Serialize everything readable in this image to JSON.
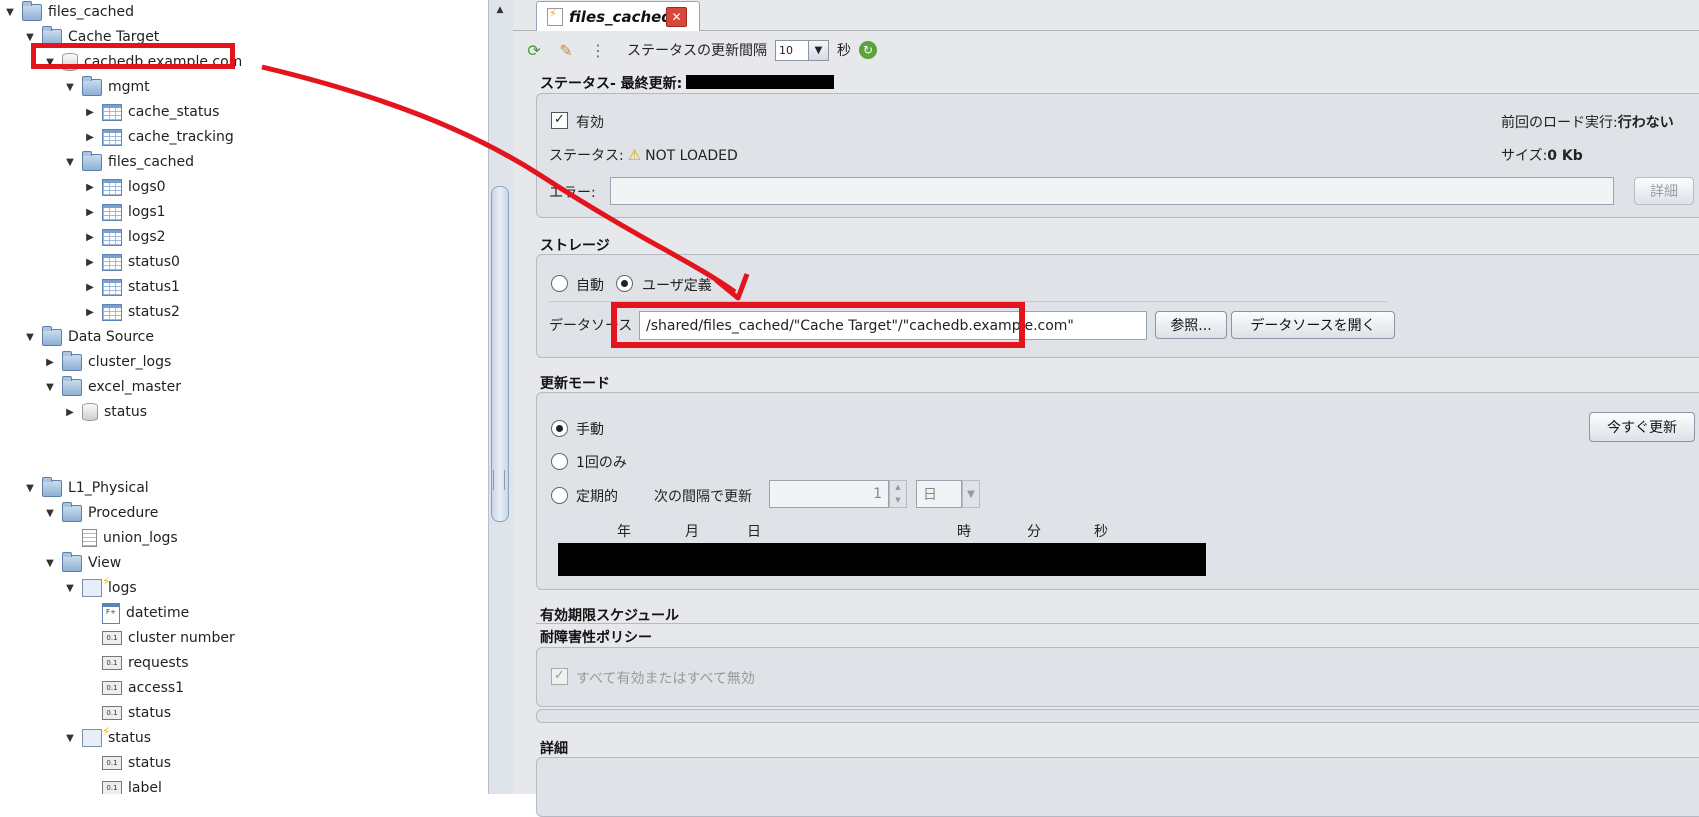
{
  "tree": {
    "items": [
      {
        "label": "files_cached",
        "icon": "folder",
        "toggle": "▼",
        "level": 0
      },
      {
        "label": "Cache Target",
        "icon": "folder",
        "toggle": "▼",
        "level": 1
      },
      {
        "label": "cachedb.example.com",
        "icon": "database",
        "toggle": "▼",
        "level": 2
      },
      {
        "label": "mgmt",
        "icon": "folder",
        "toggle": "▼",
        "level": 3
      },
      {
        "label": "cache_status",
        "icon": "table",
        "toggle": "▶",
        "level": 4
      },
      {
        "label": "cache_tracking",
        "icon": "table",
        "toggle": "▶",
        "level": 4
      },
      {
        "label": "files_cached",
        "icon": "folder",
        "toggle": "▼",
        "level": 3
      },
      {
        "label": "logs0",
        "icon": "table",
        "toggle": "▶",
        "level": 4
      },
      {
        "label": "logs1",
        "icon": "table",
        "toggle": "▶",
        "level": 4
      },
      {
        "label": "logs2",
        "icon": "table",
        "toggle": "▶",
        "level": 4
      },
      {
        "label": "status0",
        "icon": "table",
        "toggle": "▶",
        "level": 4
      },
      {
        "label": "status1",
        "icon": "table",
        "toggle": "▶",
        "level": 4
      },
      {
        "label": "status2",
        "icon": "table",
        "toggle": "▶",
        "level": 4
      },
      {
        "label": "Data Source",
        "icon": "folder",
        "toggle": "▼",
        "level": 1
      },
      {
        "label": "cluster_logs",
        "icon": "folder",
        "toggle": "▶",
        "level": 2
      },
      {
        "label": "excel_master",
        "icon": "folder",
        "toggle": "▼",
        "level": 2
      },
      {
        "label": "status",
        "icon": "database",
        "toggle": "▶",
        "level": 3
      },
      {
        "label": "L1_Physical",
        "icon": "folder",
        "toggle": "▼",
        "level": 1
      },
      {
        "label": "Procedure",
        "icon": "folder",
        "toggle": "▼",
        "level": 2
      },
      {
        "label": "union_logs",
        "icon": "document",
        "toggle": "",
        "level": 3
      },
      {
        "label": "View",
        "icon": "folder",
        "toggle": "▼",
        "level": 2
      },
      {
        "label": "logs",
        "icon": "view",
        "toggle": "▼",
        "level": 3
      },
      {
        "label": "datetime",
        "icon": "calendar",
        "toggle": "",
        "level": 4
      },
      {
        "label": "cluster number",
        "icon": "column",
        "toggle": "",
        "level": 4
      },
      {
        "label": "requests",
        "icon": "column",
        "toggle": "",
        "level": 4
      },
      {
        "label": "access1",
        "icon": "column",
        "toggle": "",
        "level": 4
      },
      {
        "label": "status",
        "icon": "column",
        "toggle": "",
        "level": 4
      },
      {
        "label": "status",
        "icon": "view",
        "toggle": "▼",
        "level": 3
      },
      {
        "label": "status",
        "icon": "column",
        "toggle": "",
        "level": 4
      },
      {
        "label": "label",
        "icon": "column",
        "toggle": "",
        "level": 4
      }
    ]
  },
  "tab": {
    "label": "files_cached",
    "close": "✕"
  },
  "toolbar": {
    "interval_label": "ステータスの更新間隔",
    "interval_value": "10",
    "interval_drop": "▼",
    "interval_unit": "秒",
    "refresh_glyph": "↻"
  },
  "status": {
    "title": "ステータス- 最終更新:",
    "enabled_check": "✓",
    "enabled_label": "有効",
    "last_load_label": "前回のロード実行:",
    "last_load_value": "行わない",
    "status_label": "ステータス:",
    "warn_glyph": "⚠",
    "status_value": "NOT LOADED",
    "size_label": "サイズ:",
    "size_value": "0 Kb",
    "error_label": "エラー:",
    "error_value": "",
    "detail_button": "詳細"
  },
  "storage": {
    "title": "ストレージ",
    "auto_label": "自動",
    "user_defined_label": "ユーザ定義",
    "datasource_label": "データソース",
    "datasource_path": "/shared/files_cached/\"Cache Target\"/\"cachedb.example.com\"",
    "browse_button": "参照...",
    "open_button": "データソースを開く"
  },
  "refresh_mode": {
    "title": "更新モード",
    "manual_label": "手動",
    "once_label": "1回のみ",
    "periodic_label": "定期的",
    "interval_text": "次の間隔で更新",
    "interval_value": "1",
    "unit_value": "日",
    "unit_drop": "▼",
    "refresh_now_button": "今すぐ更新",
    "time_headers": [
      "年",
      "月",
      "日",
      "時",
      "分",
      "秒"
    ]
  },
  "expiry": {
    "title": "有効期限スケジュール"
  },
  "fault_tolerance": {
    "title": "耐障害性ポリシー",
    "all_toggle_check": "✓",
    "all_toggle_label": "すべて有効またはすべて無効"
  },
  "details": {
    "title": "詳細"
  },
  "colors": {
    "highlight": "#e3141d",
    "panel_bg": "#e6e8ec"
  }
}
